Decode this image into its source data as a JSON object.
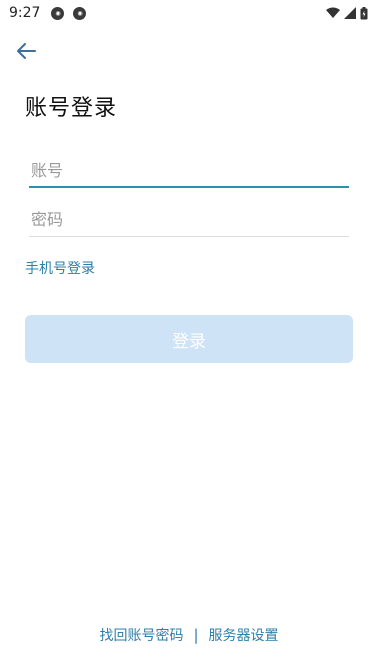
{
  "status_bar": {
    "time": "9:27",
    "notifications": [
      "notification-icon",
      "notification-icon"
    ],
    "right_icons": [
      "wifi-icon",
      "signal-icon",
      "battery-icon"
    ]
  },
  "header": {
    "back_icon": "arrow-left-icon",
    "title": "账号登录"
  },
  "form": {
    "account_placeholder": "账号",
    "account_value": "",
    "password_placeholder": "密码",
    "password_value": "",
    "phone_login_link": "手机号登录",
    "login_button": "登录",
    "login_enabled": false
  },
  "footer": {
    "recover_link": "找回账号密码",
    "separator": "|",
    "server_settings_link": "服务器设置"
  },
  "colors": {
    "accent": "#2e7fa8",
    "input_focus_underline": "#2f8fa5",
    "button_disabled_bg": "#cfe3f7",
    "back_arrow": "#3b6fa0"
  }
}
